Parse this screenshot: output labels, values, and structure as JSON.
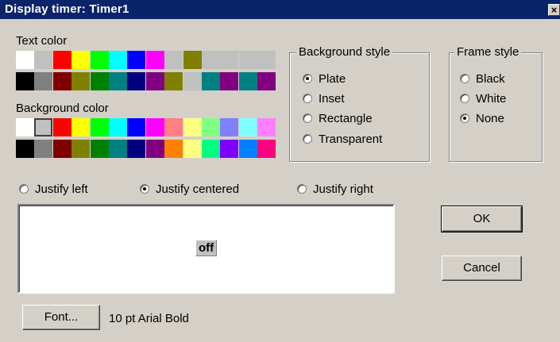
{
  "window": {
    "title": "Display timer: Timer1",
    "close_label": "×"
  },
  "text_color": {
    "label": "Text color",
    "row1": [
      "#ffffff",
      "#c0c0c0",
      "#ff0000",
      "#ffff00",
      "#00ff00",
      "#00ffff",
      "#0000ff",
      "#ff00ff",
      "#c0c0c0",
      "#808000",
      "#c0c0c0",
      "#c0c0c0",
      "#c0c0c0",
      "#c0c0c0"
    ],
    "row2": [
      "#000000",
      "#808080",
      "#800000",
      "#808000",
      "#008000",
      "#008080",
      "#000080",
      "#800080",
      "#808000",
      "#c0c0c0",
      "#008080",
      "#800080",
      "#008080",
      "#800080"
    ]
  },
  "background_color": {
    "label": "Background color",
    "selected_index": 1,
    "row1": [
      "#ffffff",
      "#c0c0c0",
      "#ff0000",
      "#ffff00",
      "#00ff00",
      "#00ffff",
      "#0000ff",
      "#ff00ff",
      "#ff8080",
      "#ffff80",
      "#80ff80",
      "#8080ff",
      "#80ffff",
      "#ff80ff"
    ],
    "row2": [
      "#000000",
      "#808080",
      "#800000",
      "#808000",
      "#008000",
      "#008080",
      "#000080",
      "#800080",
      "#ff8000",
      "#ffff80",
      "#00ff80",
      "#8000ff",
      "#0080ff",
      "#ff0080"
    ]
  },
  "background_style": {
    "title": "Background style",
    "options": [
      "Plate",
      "Inset",
      "Rectangle",
      "Transparent"
    ],
    "selected": "Plate"
  },
  "frame_style": {
    "title": "Frame style",
    "options": [
      "Black",
      "White",
      "None"
    ],
    "selected": "None"
  },
  "justify": {
    "options": [
      "Justify left",
      "Justify centered",
      "Justify right"
    ],
    "selected": "Justify centered"
  },
  "preview": {
    "text": "off"
  },
  "buttons": {
    "ok": "OK",
    "cancel": "Cancel",
    "font": "Font..."
  },
  "font_description": "10 pt Arial Bold"
}
